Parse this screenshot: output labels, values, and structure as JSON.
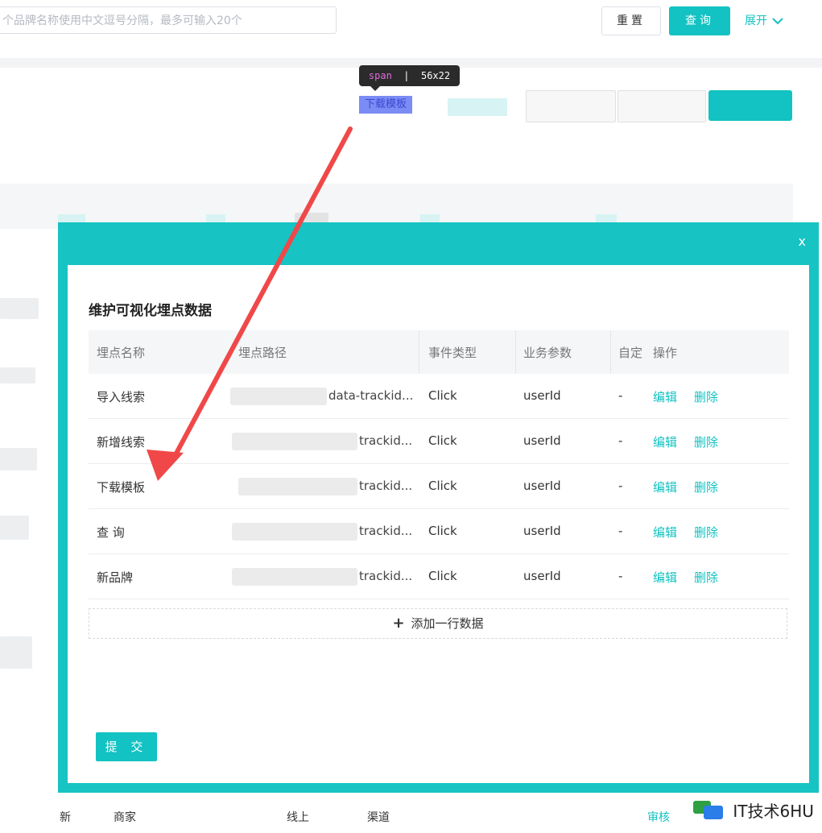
{
  "filter": {
    "brand_placeholder": "个品牌名称使用中文逗号分隔，最多可输入20个",
    "reset_label": "重置",
    "query_label": "查询",
    "expand_label": "展开"
  },
  "inspector": {
    "tag": "span",
    "size": "56x22"
  },
  "toolbar": {
    "download_template_label": "下载模板"
  },
  "modal": {
    "close_label": "x",
    "title": "维护可视化埋点数据",
    "columns": [
      "埋点名称",
      "埋点路径",
      "事件类型",
      "业务参数",
      "自定",
      "操作"
    ],
    "rows": [
      {
        "name": "导入线索",
        "path": "data-trackid...",
        "event": "Click",
        "param": "userId",
        "custom": "-",
        "edit": "编辑",
        "delete": "删除"
      },
      {
        "name": "新增线索",
        "path": "trackid...",
        "event": "Click",
        "param": "userId",
        "custom": "-",
        "edit": "编辑",
        "delete": "删除"
      },
      {
        "name": "下载模板",
        "path": "trackid...",
        "event": "Click",
        "param": "userId",
        "custom": "-",
        "edit": "编辑",
        "delete": "删除"
      },
      {
        "name": "查 询",
        "path": "trackid...",
        "event": "Click",
        "param": "userId",
        "custom": "-",
        "edit": "编辑",
        "delete": "删除"
      },
      {
        "name": "新品牌",
        "path": "trackid...",
        "event": "Click",
        "param": "userId",
        "custom": "-",
        "edit": "编辑",
        "delete": "删除"
      }
    ],
    "add_row_label": "添加一行数据",
    "submit_label": "提 交"
  },
  "bottom_row": {
    "cell_merchant": "商家",
    "cell_line": "线上",
    "cell_channel": "渠道",
    "cell_review": "审核"
  },
  "watermark": "IT技术6HU",
  "colors": {
    "accent": "#13c2c2",
    "arrow": "#f04848"
  }
}
